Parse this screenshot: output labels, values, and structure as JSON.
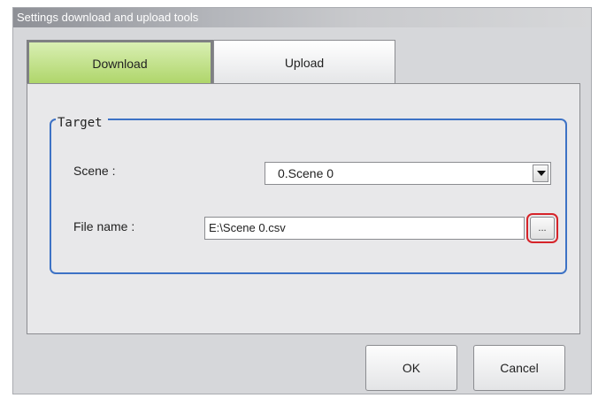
{
  "window": {
    "title": "Settings download and upload tools"
  },
  "tabs": [
    {
      "label": "Download",
      "active": true
    },
    {
      "label": "Upload",
      "active": false
    }
  ],
  "target": {
    "legend": "Target",
    "scene_label": "Scene :",
    "scene_value": "0.Scene 0",
    "file_label": "File name :",
    "file_value": "E:\\Scene 0.csv",
    "browse_label": "..."
  },
  "buttons": {
    "ok": "OK",
    "cancel": "Cancel"
  },
  "colors": {
    "active_tab": "#aed569",
    "fieldset_border": "#3d72c5",
    "highlight": "#d6242a"
  }
}
